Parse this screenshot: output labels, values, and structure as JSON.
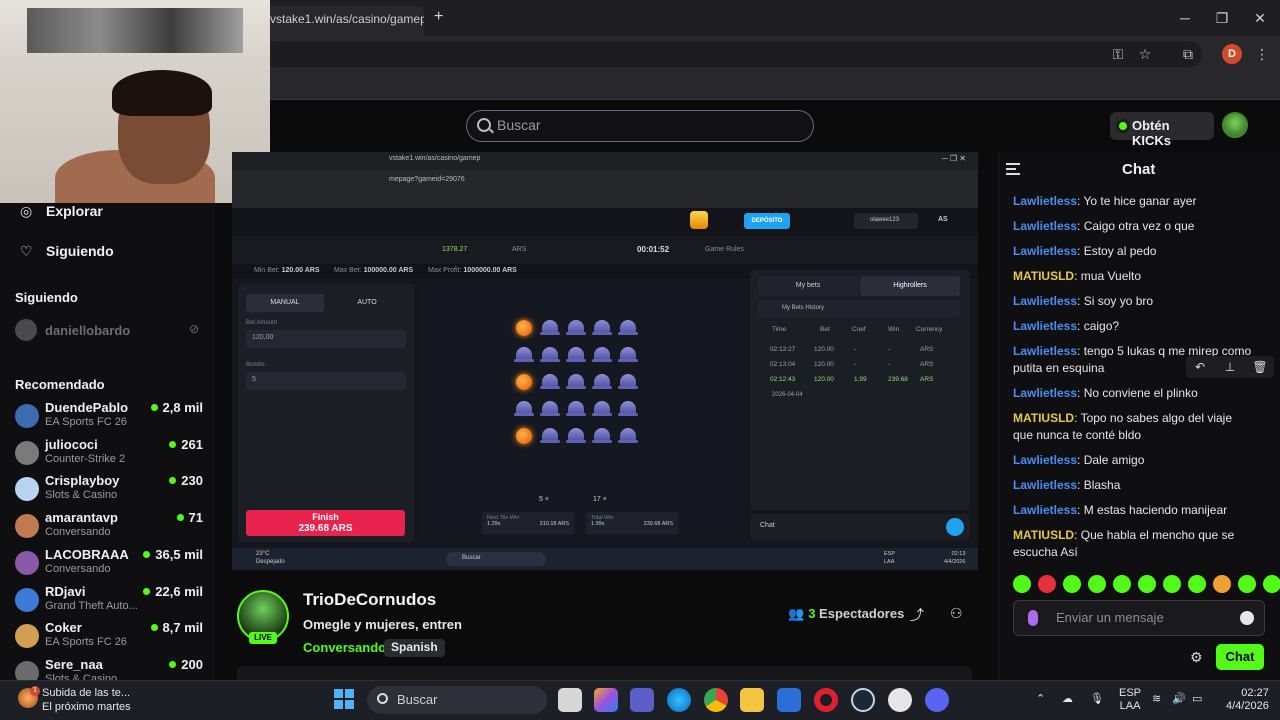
{
  "browser": {
    "tab_title": "vstake1.win/as/casino/gamep",
    "new_tab": "+",
    "window_min": "─",
    "window_max": "❐",
    "window_close": "✕",
    "profile_initial": "D"
  },
  "kick": {
    "search_placeholder": "Buscar",
    "get_kicks_label": "Obtén KICKs"
  },
  "sidebar": {
    "explore": "Explorar",
    "following": "Siguiendo",
    "following_section": "Siguiendo",
    "followed_channel": "daniellobardo",
    "recommended_section": "Recomendado",
    "recommended": [
      {
        "name": "DuendePablo",
        "category": "EA Sports FC 26",
        "viewers": "2,8 mil"
      },
      {
        "name": "juliococi",
        "category": "Counter-Strike 2",
        "viewers": "261"
      },
      {
        "name": "Crisplayboy",
        "category": "Slots & Casino",
        "viewers": "230"
      },
      {
        "name": "amarantavp",
        "category": "Conversando",
        "viewers": "71"
      },
      {
        "name": "LACOBRAAA",
        "category": "Conversando",
        "viewers": "36,5 mil"
      },
      {
        "name": "RDjavi",
        "category": "Grand Theft Auto...",
        "viewers": "22,6 mil"
      },
      {
        "name": "Coker",
        "category": "EA Sports FC 26",
        "viewers": "8,7 mil"
      },
      {
        "name": "Sere_naa",
        "category": "Slots & Casino",
        "viewers": "200"
      }
    ]
  },
  "stream_screen": {
    "inner_tab": "vstake1.win/as/casino/gamep",
    "inner_url": "mepage?gameid=29076",
    "deposit": "DEPÓSITO",
    "username": "olawee123",
    "currency": "AS",
    "balance": "1378.27",
    "balance_currency": "ARS",
    "timer": "00:01:52",
    "game_rules": "Game Rules",
    "min_bet": "Min Bet:",
    "min_bet_val": "120.00 ARS",
    "max_bet": "Max Bet:",
    "max_bet_val": "100000.00 ARS",
    "max_profit": "Max Profit:",
    "max_profit_val": "1000000.00 ARS",
    "manual": "MANUAL",
    "auto": "AUTO",
    "bet_amount_label": "Bet Amount",
    "bet_amount": "120,00",
    "bombs_label": "Bombs",
    "bombs": "5",
    "finish_label": "Finish",
    "finish_amount": "239.68 ARS",
    "bombs_count": "5 ×",
    "gems_count": "17 ×",
    "next_tile_label": "Next Tile Win",
    "next_tile_coef": "1.29x",
    "next_tile_val": "310.18 ARS",
    "total_win_label": "Total Win",
    "total_win_coef": "1.99x",
    "total_win_val": "239.68 ARS",
    "tabs": [
      "My bets",
      "Highrollers"
    ],
    "history_title": "My Bets History",
    "history_headers": [
      "Time",
      "Bet",
      "Coef",
      "Win",
      "Currency"
    ],
    "history_rows": [
      {
        "time": "02:13:27",
        "bet": "120.00",
        "coef": "-",
        "win": "-",
        "cur": "ARS",
        "win_row": false
      },
      {
        "time": "02:13:04",
        "bet": "120.00",
        "coef": "-",
        "win": "-",
        "cur": "ARS",
        "win_row": false
      },
      {
        "time": "02:12:43",
        "bet": "120.00",
        "coef": "1.99",
        "win": "239.68",
        "cur": "ARS",
        "win_row": true
      }
    ],
    "history_date": "2026-04-04",
    "chat_label": "Chat",
    "weather_temp": "23°C",
    "weather_desc": "Despejado",
    "taskbar_search": "Buscar",
    "lang1": "ESP",
    "lang2": "LAA",
    "clock_time": "02:13",
    "clock_date": "4/4/2026"
  },
  "stream_info": {
    "channel": "TrioDeCornudos",
    "title": "Omegle y mujeres, entren",
    "category": "Conversando",
    "language": "Spanish",
    "live": "LIVE",
    "viewer_count": "3",
    "viewer_label": "Espectadores"
  },
  "chat": {
    "title": "Chat",
    "messages": [
      {
        "user": "Lawlietless",
        "text": "Yo te hice ganar ayer",
        "color": "blue"
      },
      {
        "user": "Lawlietless",
        "text": "Caigo otra vez o que",
        "color": "blue"
      },
      {
        "user": "Lawlietless",
        "text": "Estoy al pedo",
        "color": "blue"
      },
      {
        "user": "MATIUSLD",
        "text": "mua Vuelto",
        "color": "yellow"
      },
      {
        "user": "Lawlietless",
        "text": "Si soy yo bro",
        "color": "blue"
      },
      {
        "user": "Lawlietless",
        "text": "caigo?",
        "color": "blue"
      },
      {
        "user": "Lawlietless",
        "text": "tengo 5 lukas q me mirep como putita en esquina",
        "color": "blue"
      },
      {
        "user": "Lawlietless",
        "text": "No conviene el plinko",
        "color": "blue"
      },
      {
        "user": "MATIUSLD",
        "text": "Topo no sabes algo del viaje que nunca te conté bldo",
        "color": "yellow"
      },
      {
        "user": "Lawlietless",
        "text": "Dale amigo",
        "color": "blue"
      },
      {
        "user": "Lawlietless",
        "text": "Blasha",
        "color": "blue"
      },
      {
        "user": "Lawlietless",
        "text": "M estas haciendo manijear",
        "color": "blue"
      },
      {
        "user": "MATIUSLD",
        "text": "Que habla el mencho que se escucha Así",
        "color": "yellow"
      }
    ],
    "input_placeholder": "Enviar un mensaje",
    "send_label": "Chat"
  },
  "taskbar": {
    "weather_title": "Subida de las te...",
    "weather_sub": "El próximo martes",
    "weather_badge": "1",
    "search": "Buscar",
    "lang1": "ESP",
    "lang2": "LAA",
    "time": "02:27",
    "date": "4/4/2026"
  },
  "colors": {
    "kick_green": "#53fc18",
    "user_blue": "#4a8ef0",
    "user_yellow": "#e4c84a",
    "finish_red": "#e8234d"
  }
}
